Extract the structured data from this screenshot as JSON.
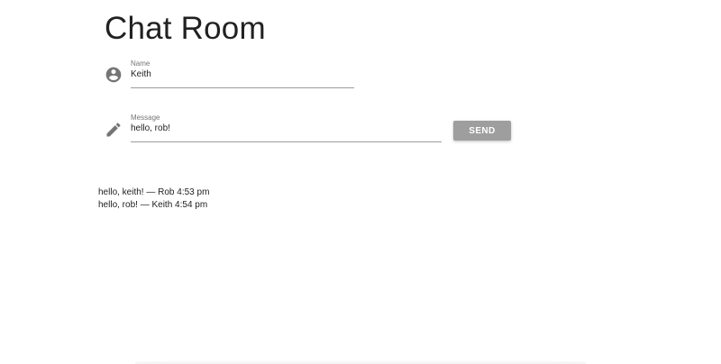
{
  "page": {
    "title": "Chat Room"
  },
  "form": {
    "name": {
      "icon": "account-circle-icon",
      "label": "Name",
      "value": "Keith"
    },
    "message": {
      "icon": "pencil-icon",
      "label": "Message",
      "value": "hello, rob!"
    },
    "send_label": "SEND"
  },
  "messages": [
    {
      "text": "hello, keith! — Rob 4:53 pm"
    },
    {
      "text": "hello, rob! — Keith 4:54 pm"
    }
  ],
  "colors": {
    "text": "#212121",
    "label": "#757575",
    "underline": "#9e9e9e",
    "icon": "#757575",
    "button_bg": "#9e9e9e",
    "button_text": "#ffffff"
  }
}
